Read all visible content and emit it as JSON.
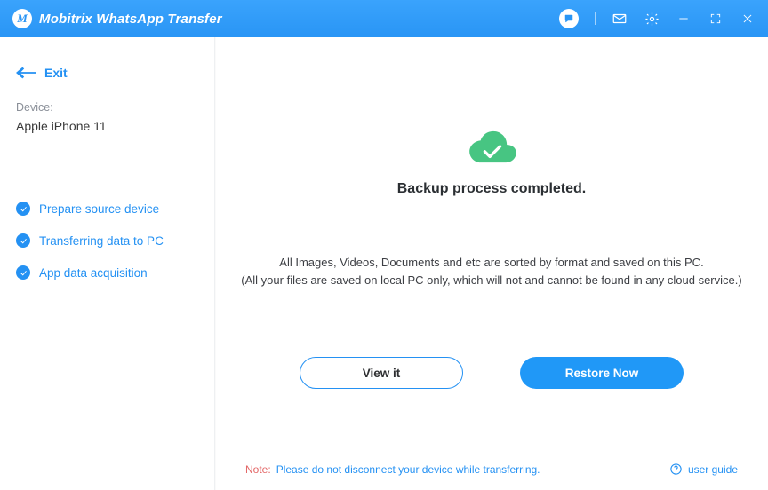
{
  "titlebar": {
    "brand_logo": "M",
    "brand_title": "Mobitrix WhatsApp Transfer"
  },
  "sidebar": {
    "exit_label": "Exit",
    "device_label": "Device:",
    "device_name": "Apple iPhone 11",
    "steps": [
      {
        "label": "Prepare source device"
      },
      {
        "label": "Transferring data to PC"
      },
      {
        "label": "App data acquisition"
      }
    ]
  },
  "main": {
    "headline": "Backup process completed.",
    "desc_line1": "All Images, Videos, Documents and etc are sorted by format and saved on this PC.",
    "desc_line2": "(All your files are saved on local PC only, which will not and cannot be found in any cloud service.)",
    "view_button": "View it",
    "restore_button": "Restore Now"
  },
  "footer": {
    "note_label": "Note:",
    "note_text": "Please do not disconnect your device while transferring.",
    "guide_label": "user guide"
  }
}
